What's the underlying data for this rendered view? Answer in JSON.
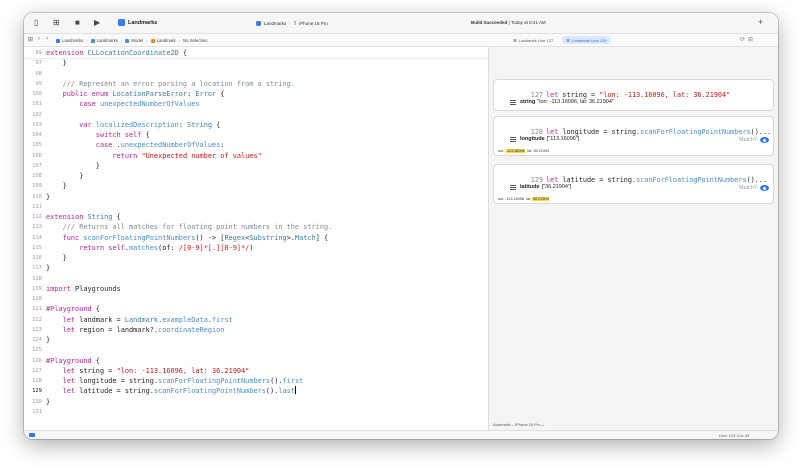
{
  "toolbar": {
    "scheme": "Landmarks",
    "destination_scheme": "Landmarks",
    "destination_device": "iPhone 16 Pro",
    "status_bold": "Build Succeeded",
    "status_time": "| Today at 9:41 AM"
  },
  "breadcrumb": [
    "Landmarks",
    "Landmarks",
    "Model",
    "Landmark",
    "No Selection"
  ],
  "canvas_tabs": [
    {
      "label": "Landmark  Line 127",
      "active": false
    },
    {
      "label": "Landmark  Line 129",
      "active": true
    }
  ],
  "editor": {
    "current_line": "129",
    "lines": [
      {
        "n": "89",
        "html": "<span class='kw'>extension</span> <span class='ty'>CLLocationCoordinate2D</span> {"
      },
      {
        "n": "97",
        "html": "    }"
      },
      {
        "n": "98",
        "html": ""
      },
      {
        "n": "99",
        "html": "    <span class='cm'>/// Represent an error parsing a location from a string.</span>"
      },
      {
        "n": "100",
        "html": "    <span class='kw'>public enum</span> <span class='ty'>LocationParseError</span>: <span class='ty'>Error</span> {"
      },
      {
        "n": "101",
        "html": "        <span class='kw'>case</span> <span class='fn'>unexpectedNumberOfValues</span>"
      },
      {
        "n": "102",
        "html": ""
      },
      {
        "n": "103",
        "html": "        <span class='kw'>var</span> <span class='fn'>localizedDescription</span>: <span class='ty'>String</span> {"
      },
      {
        "n": "104",
        "html": "            <span class='kw'>switch self</span> {"
      },
      {
        "n": "105",
        "html": "            <span class='kw'>case</span> .<span class='fn'>unexpectedNumberOfValues</span>:"
      },
      {
        "n": "106",
        "html": "                <span class='kw'>return</span> <span class='str'>\"Unexpected number of values\"</span>"
      },
      {
        "n": "107",
        "html": "            }"
      },
      {
        "n": "108",
        "html": "        }"
      },
      {
        "n": "109",
        "html": "    }"
      },
      {
        "n": "110",
        "html": "}"
      },
      {
        "n": "111",
        "html": ""
      },
      {
        "n": "112",
        "html": "<span class='kw'>extension</span> <span class='ty'>String</span> {"
      },
      {
        "n": "113",
        "html": "    <span class='cm'>/// Returns all matches for floating point numbers in the string.</span>"
      },
      {
        "n": "114",
        "html": "    <span class='kw'>func</span> <span class='fn'>scanForFloatingPointNumbers</span>() -&gt; [<span class='ty'>Regex</span>&lt;<span class='ty'>Substring</span>&gt;.<span class='ty'>Match</span>] {"
      },
      {
        "n": "115",
        "html": "        <span class='kw'>return self</span>.<span class='fn'>matches</span>(of: <span class='str'>/[0-9]*[.][0-9]*/</span>)"
      },
      {
        "n": "116",
        "html": "    }"
      },
      {
        "n": "117",
        "html": "}"
      },
      {
        "n": "118",
        "html": ""
      },
      {
        "n": "119",
        "html": "<span class='kw'>import</span> Playgrounds"
      },
      {
        "n": "120",
        "html": ""
      },
      {
        "n": "121",
        "html": "<span class='kw'>#Playground</span> {"
      },
      {
        "n": "122",
        "html": "    <span class='kw'>let</span> landmark = <span class='ty'>Landmark</span>.<span class='fn'>exampleData</span>.<span class='fn'>first</span>"
      },
      {
        "n": "123",
        "html": "    <span class='kw'>let</span> region = landmark?.<span class='fn'>coordinateRegion</span>"
      },
      {
        "n": "124",
        "html": "}"
      },
      {
        "n": "125",
        "html": ""
      },
      {
        "n": "126",
        "html": "<span class='kw'>#Playground</span> {"
      },
      {
        "n": "127",
        "html": "    <span class='kw'>let</span> string = <span class='str'>\"lon: -113.16096, lat: 36.21904\"</span>"
      },
      {
        "n": "128",
        "html": "    <span class='kw'>let</span> longitude = string.<span class='fn'>scanForFloatingPointNumbers</span>().<span class='fn'>first</span>"
      },
      {
        "n": "129",
        "html": "    <span class='kw'>let</span> latitude = string.<span class='fn'>scanForFloatingPointNumbers</span>().<span class='fn'>last</span><span class='caret'></span>"
      },
      {
        "n": "130",
        "html": "}"
      },
      {
        "n": "131",
        "html": ""
      }
    ]
  },
  "results": {
    "card1": {
      "line_no": "127",
      "code_html": "<span class='kw'>let</span> string = <span class='str'>\"lon: -113.16096, lat: 36.21904\"</span>",
      "name": "string",
      "value": "\"lon: -113.16096, lat: 36.21904\""
    },
    "card2": {
      "line_no": "128",
      "code_html": "<span class='kw'>let</span> longitude = string.<span class='fn'>scanForFloatingPointNumbers</span>()...",
      "name": "longitude",
      "value": "[\"113.16096\"]",
      "match_label": "Match?",
      "source_html": "lon: -<span class='hl'>113.16096</span>, lat: 36.21904"
    },
    "card3": {
      "line_no": "129",
      "code_html": "<span class='kw'>let</span> latitude = string.<span class='fn'>scanForFloatingPointNumbers</span>()...",
      "name": "latitude",
      "value": "[\"36.21904\"]",
      "match_label": "Match?",
      "source_html": "lon: -113.16096, lat: <span class='hl'>36.21904</span>"
    }
  },
  "canvas_footer": "Automatic – iPhone 16 Pro  ⌄",
  "statusbar": {
    "position": "Line: 129  Col: 43"
  }
}
